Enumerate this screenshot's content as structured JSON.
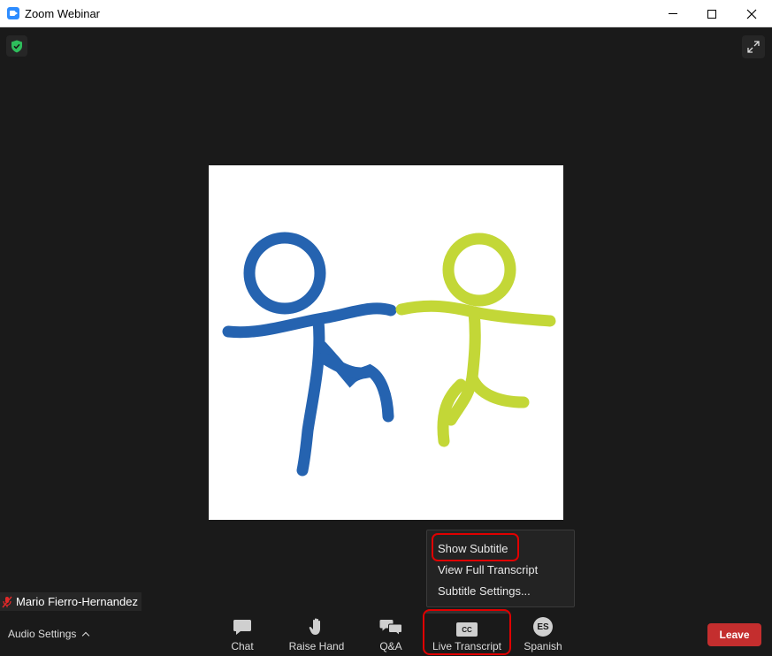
{
  "window": {
    "title": "Zoom Webinar"
  },
  "participant": {
    "name": "Mario Fierro-Hernandez"
  },
  "menu": {
    "items": [
      {
        "label": "Show Subtitle"
      },
      {
        "label": "View Full Transcript"
      },
      {
        "label": "Subtitle Settings..."
      }
    ]
  },
  "toolbar": {
    "audio_settings": "Audio Settings",
    "buttons": [
      {
        "label": "Chat",
        "icon": "chat-icon"
      },
      {
        "label": "Raise Hand",
        "icon": "raise-hand-icon"
      },
      {
        "label": "Q&A",
        "icon": "qa-icon"
      },
      {
        "label": "Live Transcript",
        "icon": "cc-icon",
        "icon_text": "CC"
      },
      {
        "label": "Spanish",
        "icon": "language-icon",
        "icon_text": "ES"
      }
    ],
    "leave": "Leave"
  },
  "colors": {
    "accent": "#2d8cff",
    "leave": "#c42e2e",
    "highlight": "#e00000",
    "figure_blue": "#2563b0",
    "figure_green": "#c3d737",
    "shield": "#2ebd5b"
  }
}
